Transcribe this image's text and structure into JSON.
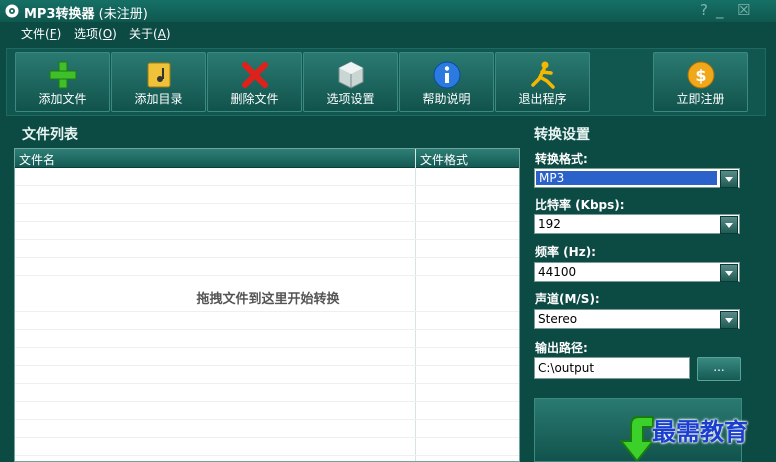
{
  "titlebar": {
    "title": "MP3转换器",
    "subtitle": "(未注册)",
    "help": "?",
    "minimize": "_",
    "close": "☒"
  },
  "menu": [
    {
      "label": "文件",
      "key": "F"
    },
    {
      "label": "选项",
      "key": "O"
    },
    {
      "label": "关于",
      "key": "A"
    }
  ],
  "toolbar": {
    "add_file": "添加文件",
    "add_dir": "添加目录",
    "delete_file": "删除文件",
    "options": "选项设置",
    "help": "帮助说明",
    "exit": "退出程序",
    "register": "立即注册"
  },
  "file_list": {
    "title": "文件列表",
    "col_name": "文件名",
    "col_format": "文件格式",
    "drop_hint": "拖拽文件到这里开始转换"
  },
  "settings": {
    "title": "转换设置",
    "format_label": "转换格式:",
    "format_value": "MP3",
    "bitrate_label": "比特率 (Kbps):",
    "bitrate_value": "192",
    "freq_label": "频率 (Hz):",
    "freq_value": "44100",
    "channel_label": "声道(M/S):",
    "channel_value": "Stereo",
    "path_label": "输出路径:",
    "path_value": "C:\\output",
    "browse": "..."
  },
  "watermark": "最需教育",
  "colors": {
    "background": "#0c4a44",
    "accent": "#2a62c9",
    "list_bg": "#ffffff"
  }
}
